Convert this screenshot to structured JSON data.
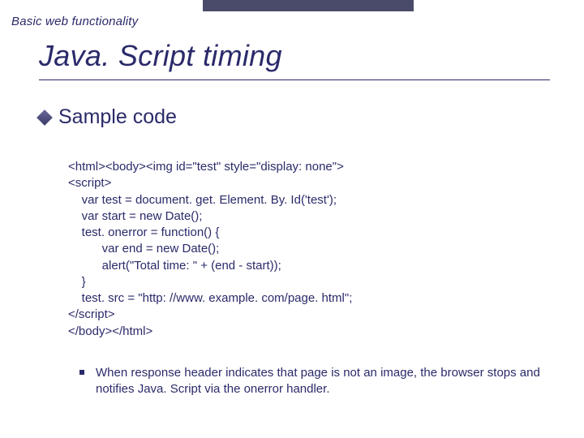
{
  "breadcrumb": "Basic web functionality",
  "title": "Java. Script timing",
  "section_heading": "Sample code",
  "code_lines": [
    "<html><body><img id=\"test\" style=\"display: none\">",
    "<script>",
    "    var test = document. get. Element. By. Id('test');",
    "    var start = new Date();",
    "    test. onerror = function() {",
    "          var end = new Date();",
    "          alert(\"Total time: \" + (end - start));",
    "    }",
    "    test. src = \"http: //www. example. com/page. html\";",
    "</script>",
    "</body></html>"
  ],
  "note": "When response header indicates that page is not an image, the browser stops and notifies Java. Script via the onerror handler."
}
